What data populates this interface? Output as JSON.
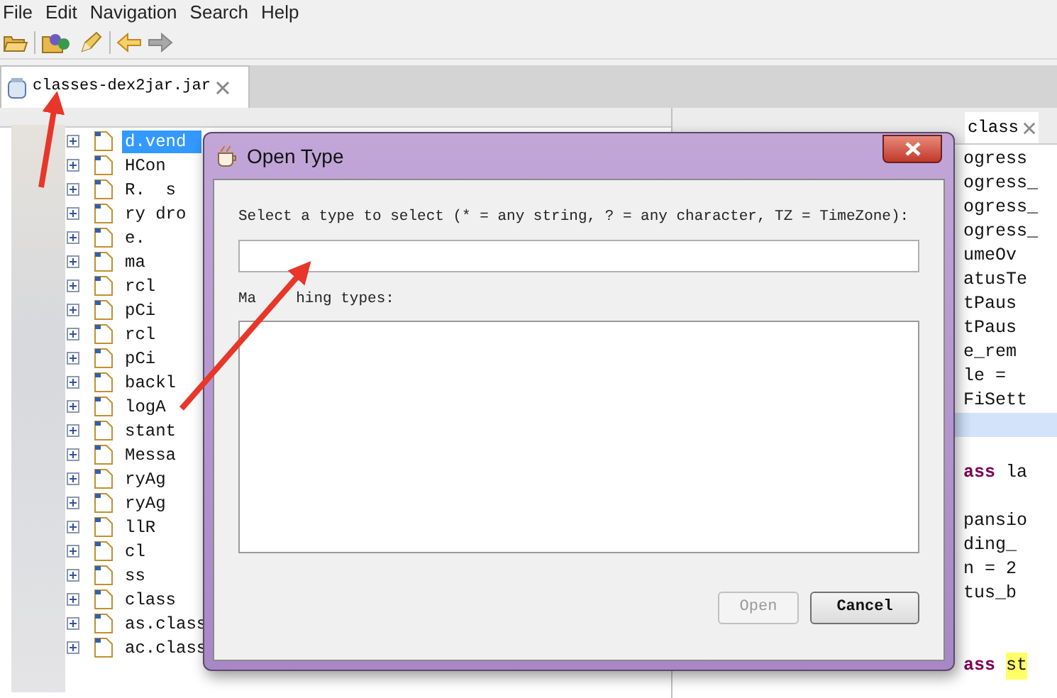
{
  "menu": [
    "File",
    "Edit",
    "Navigation",
    "Search",
    "Help"
  ],
  "editor_tab": {
    "label": "classes-dex2jar.jar"
  },
  "tree": {
    "rows": [
      {
        "text": "d.vend",
        "selected": true
      },
      {
        "text": "HCon",
        "selected": false
      },
      {
        "text": "R.  s",
        "selected": false
      },
      {
        "text": "ry dro",
        "selected": false
      },
      {
        "text": "e.",
        "selected": false
      },
      {
        "text": "ma",
        "selected": false
      },
      {
        "text": "rcl",
        "selected": false
      },
      {
        "text": "pCi",
        "selected": false
      },
      {
        "text": "rcl",
        "selected": false
      },
      {
        "text": "pCi",
        "selected": false
      },
      {
        "text": "backl",
        "selected": false
      },
      {
        "text": "logA",
        "selected": false
      },
      {
        "text": "stant",
        "selected": false
      },
      {
        "text": "Messa",
        "selected": false
      },
      {
        "text": "ryAg",
        "selected": false
      },
      {
        "text": "ryAg",
        "selected": false
      },
      {
        "text": "llR",
        "selected": false
      },
      {
        "text": "cl",
        "selected": false
      },
      {
        "text": "ss",
        "selected": false
      },
      {
        "text": "class",
        "selected": false
      },
      {
        "text": "as.class",
        "selected": false
      },
      {
        "text": "ac.class",
        "selected": false
      }
    ]
  },
  "code_tab": {
    "label": "class"
  },
  "code_lines": [
    {
      "highlighted": false,
      "segments": [
        {
          "kind": "plain",
          "text": "ogress"
        }
      ]
    },
    {
      "highlighted": false,
      "segments": [
        {
          "kind": "plain",
          "text": "ogress_"
        }
      ]
    },
    {
      "highlighted": false,
      "segments": [
        {
          "kind": "plain",
          "text": "ogress_"
        }
      ]
    },
    {
      "highlighted": false,
      "segments": [
        {
          "kind": "plain",
          "text": "ogress_"
        }
      ]
    },
    {
      "highlighted": false,
      "segments": [
        {
          "kind": "plain",
          "text": "umeOv"
        }
      ]
    },
    {
      "highlighted": false,
      "segments": [
        {
          "kind": "plain",
          "text": "atusTe"
        }
      ]
    },
    {
      "highlighted": false,
      "segments": [
        {
          "kind": "plain",
          "text": "tPaus"
        }
      ]
    },
    {
      "highlighted": false,
      "segments": [
        {
          "kind": "plain",
          "text": "tPaus"
        }
      ]
    },
    {
      "highlighted": false,
      "segments": [
        {
          "kind": "plain",
          "text": "e_rem"
        }
      ]
    },
    {
      "highlighted": false,
      "segments": [
        {
          "kind": "plain",
          "text": "le ="
        }
      ]
    },
    {
      "highlighted": false,
      "segments": [
        {
          "kind": "plain",
          "text": "FiSett"
        }
      ]
    },
    {
      "highlighted": true
    },
    {
      "highlighted": false
    },
    {
      "highlighted": false,
      "segments": [
        {
          "kind": "keyword",
          "text": "ass"
        },
        {
          "kind": "plain",
          "text": " la"
        }
      ]
    },
    {
      "highlighted": false
    },
    {
      "highlighted": false,
      "segments": [
        {
          "kind": "plain",
          "text": "pansio"
        }
      ]
    },
    {
      "highlighted": false,
      "segments": [
        {
          "kind": "plain",
          "text": "ding_"
        }
      ]
    },
    {
      "highlighted": false,
      "segments": [
        {
          "kind": "plain",
          "text": "n = 2"
        }
      ]
    },
    {
      "highlighted": false,
      "segments": [
        {
          "kind": "plain",
          "text": "tus_b"
        }
      ]
    },
    {
      "highlighted": false
    },
    {
      "highlighted": false
    },
    {
      "highlighted": false,
      "segments": [
        {
          "kind": "keyword",
          "text": "ass "
        },
        {
          "kind": "marked",
          "text": "st"
        }
      ]
    }
  ],
  "dialog": {
    "title": "Open Type",
    "prompt": "Select a type to select (* = any string, ? = any character, TZ = TimeZone):",
    "matching_label_parts": [
      "Ma",
      "hing types:"
    ],
    "buttons": [
      {
        "label": "Open",
        "disabled": true
      },
      {
        "label": "Cancel",
        "disabled": false
      }
    ]
  }
}
